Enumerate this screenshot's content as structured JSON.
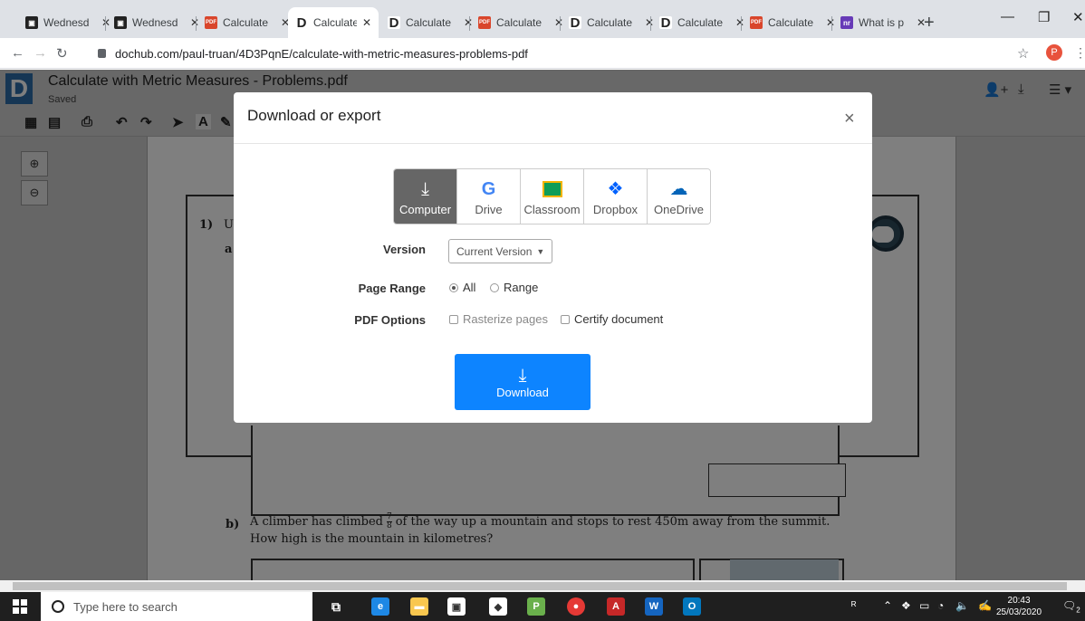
{
  "browser": {
    "tabs": [
      {
        "title": "Wednesd",
        "favicon": "ms-icon"
      },
      {
        "title": "Wednesd",
        "favicon": "ms-icon"
      },
      {
        "title": "Calculate",
        "favicon": "pdf-icon"
      },
      {
        "title": "Calculate",
        "favicon": "dochub-icon",
        "active": true
      },
      {
        "title": "Calculate",
        "favicon": "dochub-icon"
      },
      {
        "title": "Calculate",
        "favicon": "pdf-icon"
      },
      {
        "title": "Calculate",
        "favicon": "dochub-icon"
      },
      {
        "title": "Calculate",
        "favicon": "dochub-icon"
      },
      {
        "title": "Calculate",
        "favicon": "pdf-icon"
      },
      {
        "title": "What is p",
        "favicon": "nr-icon"
      }
    ],
    "close_glyph": "✕",
    "new_tab": "+",
    "url": "dochub.com/paul-truan/4D3PqnE/calculate-with-metric-measures-problems-pdf",
    "profile_initial": "P"
  },
  "app": {
    "logo": "D",
    "title": "Calculate with Metric Measures - Problems.pdf",
    "status": "Saved"
  },
  "document": {
    "q1_number": "1)",
    "q1_text": "U",
    "q1_part": "a",
    "qb_label": "b)",
    "qb_text_before": "A climber has climbed",
    "qb_fraction_num": "7",
    "qb_fraction_den": "8",
    "qb_text_after": "of the way up a mountain and stops to rest 450m away from the summit.",
    "qb_line2": "How high is the mountain in kilometres?"
  },
  "modal": {
    "title": "Download or export",
    "close": "×",
    "destinations": [
      {
        "label": "Computer",
        "icon": "download-icon",
        "selected": true
      },
      {
        "label": "Drive",
        "icon": "google-icon"
      },
      {
        "label": "Classroom",
        "icon": "classroom-icon"
      },
      {
        "label": "Dropbox",
        "icon": "dropbox-icon"
      },
      {
        "label": "OneDrive",
        "icon": "onedrive-icon"
      }
    ],
    "version_label": "Version",
    "version_value": "Current Version",
    "page_range_label": "Page Range",
    "page_range_options": [
      "All",
      "Range"
    ],
    "page_range_selected": "All",
    "pdf_options_label": "PDF Options",
    "pdf_options": [
      "Rasterize pages",
      "Certify document"
    ],
    "download_label": "Download"
  },
  "taskbar": {
    "search_placeholder": "Type here to search",
    "time": "20:43",
    "date": "25/03/2020",
    "notification_count": "2"
  },
  "colors": {
    "accent": "#0d84ff",
    "dochub_blue": "#2d6ca8"
  }
}
